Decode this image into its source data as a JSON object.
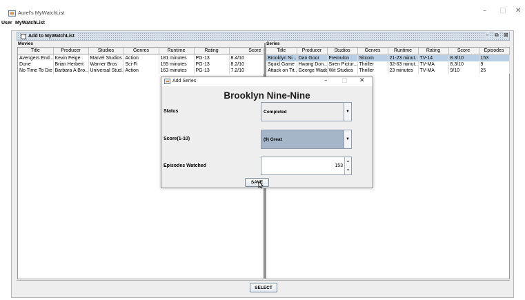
{
  "window": {
    "title": "Aurel's MyWatchList",
    "controls": {
      "minimize": "–",
      "maximize": "□",
      "close": "✕"
    }
  },
  "menubar": {
    "items": [
      "User",
      "MyWatchList"
    ]
  },
  "internal_frame": {
    "title": "Add to MyWatchList",
    "controls": {
      "iconify": "▫",
      "maximize": "⧉",
      "close": "⊠"
    }
  },
  "movies": {
    "label": "Movies",
    "columns": [
      "Title",
      "Producer",
      "Studios",
      "Genres",
      "Runtime",
      "Rating",
      "Score"
    ],
    "rows": [
      [
        "Avengers End...",
        "Kevin Feige",
        "Marvel Studios",
        "Action",
        "181 minutes",
        "PG-13",
        "8.4/10"
      ],
      [
        "Dune",
        "Brian Herbert",
        "Warner Bros",
        "Sci-Fi",
        "155 minutes",
        "PG-13",
        "8.2/10"
      ],
      [
        "No Time To Die",
        "Barbara A Bro...",
        "Universal Stud...",
        "Action",
        "163 minutes",
        "PG-13",
        "7.2/10"
      ]
    ]
  },
  "series": {
    "label": "Series",
    "columns": [
      "Title",
      "Producer",
      "Studios",
      "Genres",
      "Runtime",
      "Rating",
      "Score",
      "Episodes"
    ],
    "rows": [
      [
        "Brooklyn Ni...",
        "Dan Goor",
        "Fremulon",
        "Sitcom",
        "21-23 minut...",
        "TV-14",
        "8.3/10",
        "153"
      ],
      [
        "Squid Game",
        "Hwang Don...",
        "Siren Pictur...",
        "Thriller",
        "32-63 minut...",
        "TV-MA",
        "8.3/10",
        "9"
      ],
      [
        "Attack on Tit...",
        "George Wada",
        "Wit Studios",
        "Thriller",
        "23 minutes",
        "TV-MA",
        "9/10",
        "25"
      ]
    ],
    "selected_row": 0
  },
  "select_button": "SELECT",
  "dialog": {
    "title": "Add Series",
    "controls": {
      "minimize": "–",
      "maximize": "□",
      "close": "✕"
    },
    "heading": "Brooklyn Nine-Nine",
    "status_label": "Status",
    "status_value": "Completed",
    "score_label": "Score(1-10)",
    "score_value": "(9) Great",
    "episodes_label": "Episodes Watched",
    "episodes_value": "153",
    "save_button": "SAVE"
  },
  "colors": {
    "selection": "#b8cfe5",
    "score_combo": "#a5b6c9",
    "frame_title": "#d8e1ea"
  }
}
